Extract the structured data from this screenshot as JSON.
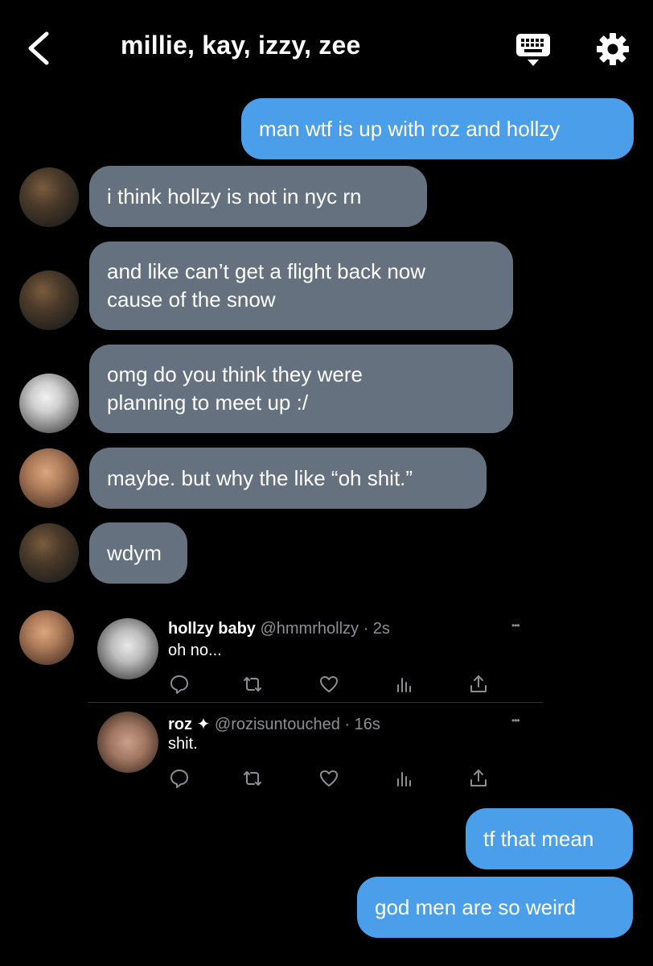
{
  "header": {
    "title": "millie, kay, izzy, zee",
    "back_icon": "chevron-left-icon",
    "keyboard_icon": "keyboard-icon",
    "settings_icon": "gear-icon"
  },
  "colors": {
    "outgoing_bubble": "#4a9eea",
    "incoming_bubble": "#65717f",
    "background": "#000000",
    "secondary_text": "#8b8f94"
  },
  "messages": [
    {
      "direction": "out",
      "text": "man wtf is up with roz and hollzy"
    },
    {
      "direction": "in",
      "text": "i think hollzy is not in nyc rn"
    },
    {
      "direction": "in",
      "lines": [
        "and like can’t get a flight back now",
        "cause of the snow"
      ]
    },
    {
      "direction": "in",
      "lines": [
        "omg do you think they were",
        "planning to meet up :/"
      ]
    },
    {
      "direction": "in",
      "text": "maybe. but why the like “oh shit.”"
    },
    {
      "direction": "in",
      "text": "wdym"
    },
    {
      "direction": "out",
      "text": "tf that mean"
    },
    {
      "direction": "out",
      "text": "god men are so weird"
    }
  ],
  "tweets": [
    {
      "name": "hollzy baby",
      "handle": "@hmmrhollzy · 2s",
      "text": "oh no...",
      "more": "•••",
      "icons": [
        "reply-icon",
        "retweet-icon",
        "like-icon",
        "analytics-icon",
        "share-icon"
      ]
    },
    {
      "name": "roz",
      "badge": "✦",
      "handle": "@rozisuntouched · 16s",
      "text": "shit.",
      "more": "•••",
      "icons": [
        "reply-icon",
        "retweet-icon",
        "like-icon",
        "analytics-icon",
        "share-icon"
      ]
    }
  ]
}
